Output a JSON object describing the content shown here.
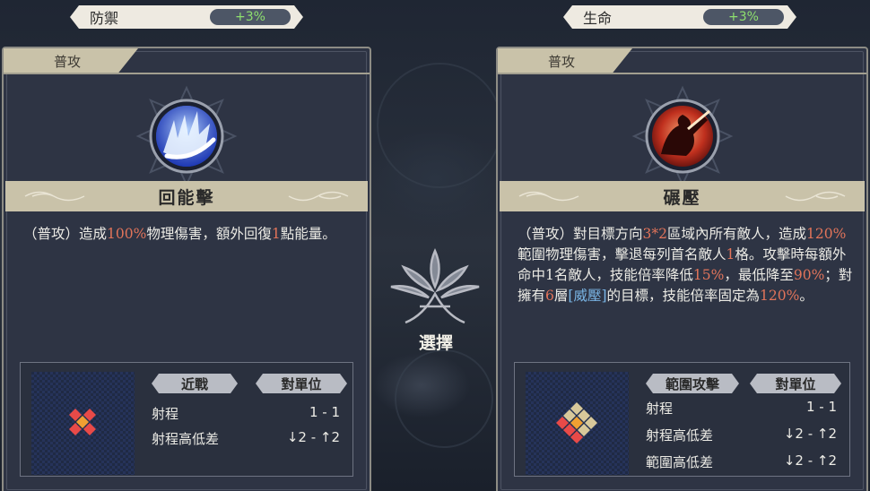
{
  "left": {
    "stat": {
      "label": "防禦",
      "value": "+3%"
    },
    "tag": "普攻",
    "skill_name": "回能擊",
    "desc": [
      {
        "t": "（普攻）造成"
      },
      {
        "t": "100%",
        "c": "hl"
      },
      {
        "t": "物理傷害，額外回復"
      },
      {
        "t": "1",
        "c": "hl"
      },
      {
        "t": "點能量。"
      }
    ],
    "pills": [
      "近戰",
      "對單位"
    ],
    "rows": [
      {
        "label": "射程",
        "value": "1 - 1"
      },
      {
        "label": "射程高低差",
        "value": "↓2 - ↑2"
      }
    ]
  },
  "right": {
    "stat": {
      "label": "生命",
      "value": "+3%"
    },
    "tag": "普攻",
    "skill_name": "碾壓",
    "desc": [
      {
        "t": "（普攻）對目標方向"
      },
      {
        "t": "3*2",
        "c": "hl"
      },
      {
        "t": "區域內所有敵人，造成"
      },
      {
        "t": "120%",
        "c": "hl"
      },
      {
        "t": "範圍物理傷害，擊退每列首名敵人"
      },
      {
        "t": "1",
        "c": "hl"
      },
      {
        "t": "格。攻擊時每額外命中1名敵人，技能倍率降低"
      },
      {
        "t": "15%",
        "c": "hl"
      },
      {
        "t": "，最低降至"
      },
      {
        "t": "90%",
        "c": "hl"
      },
      {
        "t": "；對擁有"
      },
      {
        "t": "6",
        "c": "hl"
      },
      {
        "t": "層"
      },
      {
        "t": "[威壓]",
        "c": "bl"
      },
      {
        "t": "的目標，技能倍率固定為"
      },
      {
        "t": "120%",
        "c": "hl"
      },
      {
        "t": "。"
      }
    ],
    "pills": [
      "範圍攻擊",
      "對單位"
    ],
    "rows": [
      {
        "label": "射程",
        "value": "1 - 1"
      },
      {
        "label": "射程高低差",
        "value": "↓2 - ↑2"
      },
      {
        "label": "範圍高低差",
        "value": "↓2 - ↑2"
      }
    ]
  },
  "center": {
    "label": "選擇"
  },
  "colors": {
    "highlight": "#e2745a",
    "keyword": "#7ab6e6",
    "stat_value": "#8ee06e"
  }
}
